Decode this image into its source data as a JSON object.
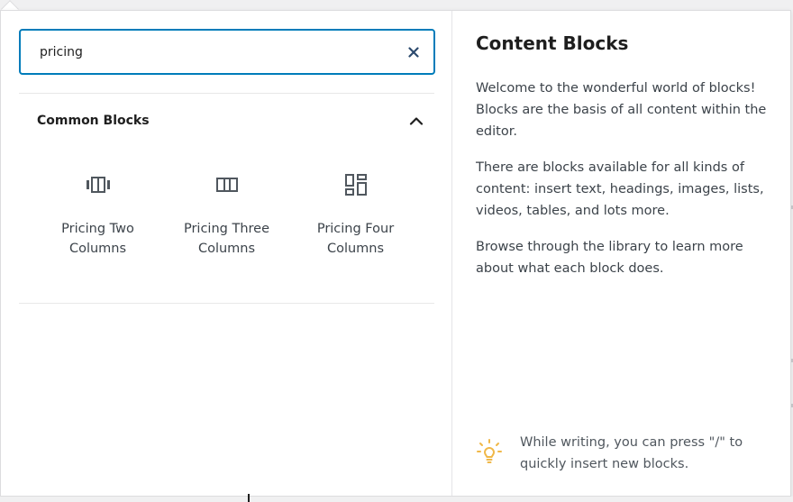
{
  "search": {
    "value": "pricing",
    "clear_icon": "close-icon"
  },
  "section": {
    "title": "Common Blocks",
    "toggle_icon": "chevron-up-icon"
  },
  "blocks": [
    {
      "label": "Pricing Two Columns",
      "icon": "two-columns-icon"
    },
    {
      "label": "Pricing Three Columns",
      "icon": "three-columns-icon"
    },
    {
      "label": "Pricing Four Columns",
      "icon": "four-columns-icon"
    }
  ],
  "info": {
    "title": "Content Blocks",
    "paragraphs": [
      "Welcome to the wonderful world of blocks! Blocks are the basis of all content within the editor.",
      "There are blocks available for all kinds of content: insert text, headings, images, lists, videos, tables, and lots more.",
      "Browse through the library to learn more about what each block does."
    ],
    "tip_icon": "lightbulb-icon",
    "tip": "While writing, you can press \"/\" to quickly insert new blocks."
  },
  "colors": {
    "focus_border": "#007cba",
    "tip_icon": "#f0b849",
    "text": "#1e1e1e",
    "muted_text": "#3c434a"
  }
}
